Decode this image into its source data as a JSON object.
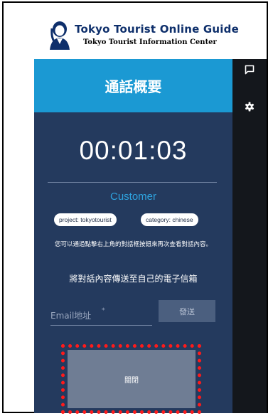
{
  "header": {
    "logo_title": "Tokyo Tourist Online Guide",
    "logo_subtitle": "Tokyo Tourist Information Center"
  },
  "panel": {
    "title": "通話概要",
    "timer": "00:01:03",
    "customer_label": "Customer",
    "tags": {
      "project": "project: tokyotourist",
      "category": "category: chinese"
    },
    "hint": "您可以通過點擊右上角的對話框按鈕來再次查看對話內容。",
    "send_title": "將對話內容傳送至自己的電子信箱",
    "email": {
      "placeholder": "Email地址",
      "required_mark": "*",
      "value": ""
    },
    "send_button": "發送",
    "close_button": "關閉"
  },
  "rail": {
    "icons": [
      "chat-icon",
      "gear-icon"
    ]
  },
  "colors": {
    "panel_bg": "#243a5e",
    "header_blue": "#1b99d3",
    "accent_blue": "#2ea3df",
    "rail_bg": "#14171c",
    "highlight_red": "#ff1a1a"
  }
}
